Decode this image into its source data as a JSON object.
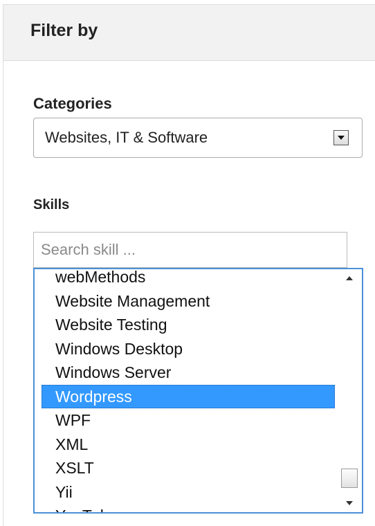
{
  "filter": {
    "title": "Filter by"
  },
  "categories": {
    "label": "Categories",
    "selected_value": "Websites, IT & Software"
  },
  "skills": {
    "label": "Skills",
    "search_placeholder": "Search skill ...",
    "items": [
      "webMethods",
      "Website Management",
      "Website Testing",
      "Windows Desktop",
      "Windows Server",
      "Wordpress",
      "WPF",
      "XML",
      "XSLT",
      "Yii",
      "YouTube"
    ],
    "selected_item": "Wordpress"
  },
  "colors": {
    "selection_background": "#3399ff",
    "listbox_border": "#4a90d9",
    "header_background": "#f2f2f2"
  }
}
